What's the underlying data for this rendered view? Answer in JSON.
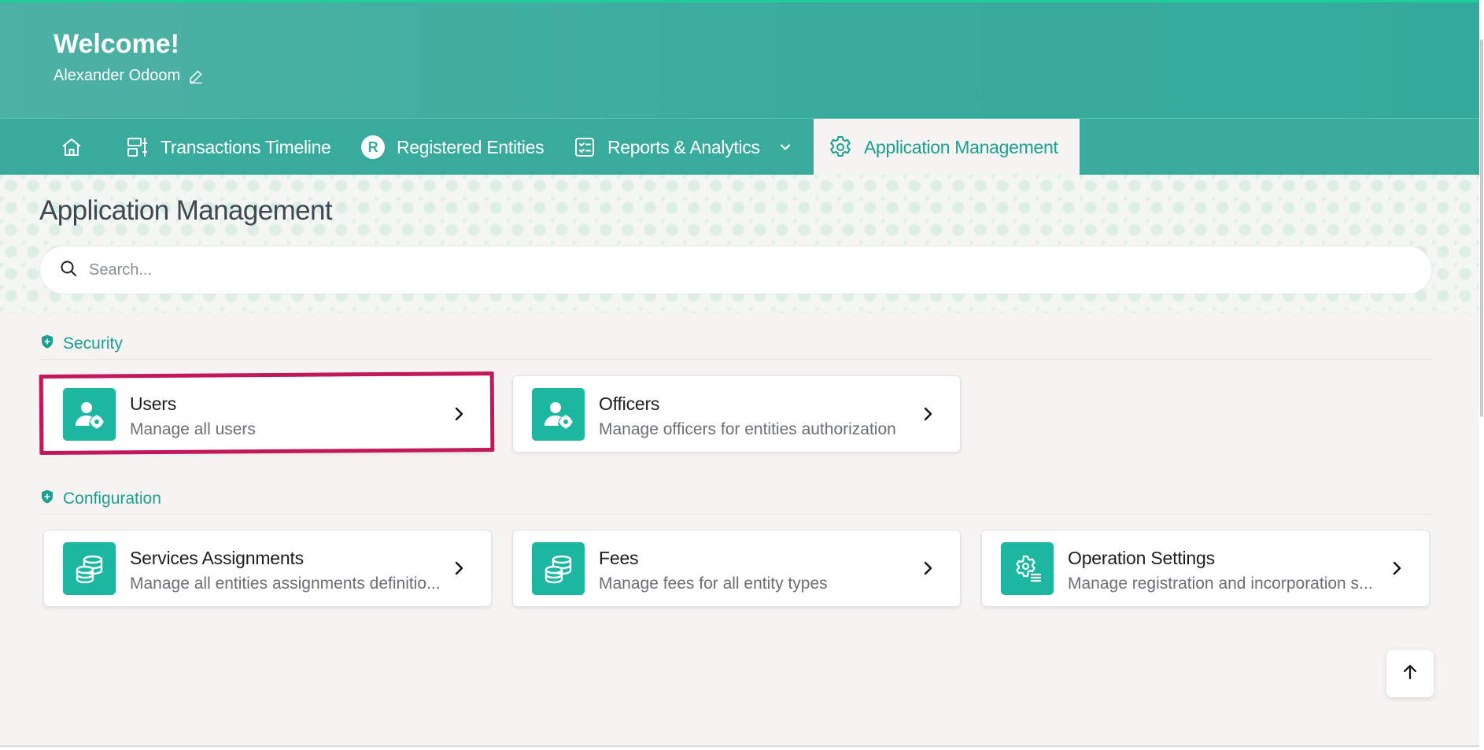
{
  "header": {
    "welcome": "Welcome!",
    "username": "Alexander Odoom",
    "edit_icon": "pencil-icon"
  },
  "nav": {
    "items": [
      {
        "label": "",
        "icon": "home-icon"
      },
      {
        "label": "Transactions Timeline",
        "icon": "timeline-icon"
      },
      {
        "label": "Registered Entities",
        "icon": "registered-r-icon"
      },
      {
        "label": "Reports & Analytics",
        "icon": "checklist-icon",
        "has_dropdown": true
      },
      {
        "label": "Application Management",
        "icon": "gear-icon",
        "active": true
      }
    ]
  },
  "page": {
    "title": "Application Management",
    "search_placeholder": "Search..."
  },
  "sections": [
    {
      "title": "Security",
      "icon": "shield-icon",
      "cards": [
        {
          "title": "Users",
          "description": "Manage all users",
          "icon": "user-gear-icon"
        },
        {
          "title": "Officers",
          "description": "Manage officers for entities authorization",
          "icon": "user-gear-icon"
        }
      ]
    },
    {
      "title": "Configuration",
      "icon": "shield-icon",
      "cards": [
        {
          "title": "Services Assignments",
          "description": "Manage all entities assignments definitio...",
          "icon": "database-icon"
        },
        {
          "title": "Fees",
          "description": "Manage fees for all entity types",
          "icon": "database-icon"
        },
        {
          "title": "Operation Settings",
          "description": "Manage registration and incorporation s...",
          "icon": "gear-list-icon"
        }
      ]
    }
  ],
  "colors": {
    "brand": "#38ab9d",
    "accent": "#1a9f90",
    "tile": "#1db6a1",
    "highlight": "#c2185b"
  },
  "scroll_top_icon": "arrow-up-icon"
}
